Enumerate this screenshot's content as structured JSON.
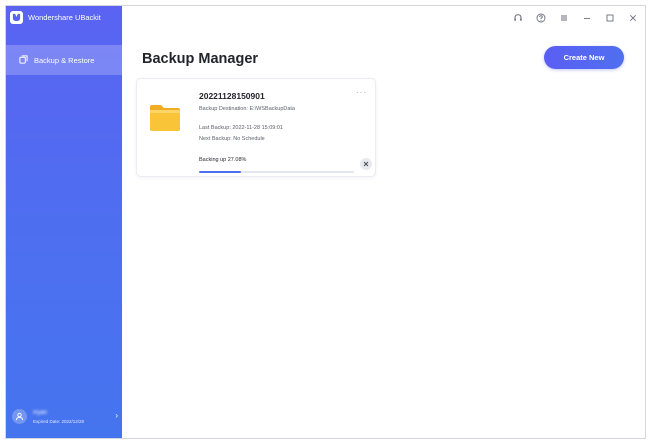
{
  "app": {
    "title": "Wondershare UBackit"
  },
  "sidebar": {
    "items": [
      {
        "label": "Backup & Restore",
        "icon": "backup-icon",
        "active": true
      }
    ],
    "user": {
      "name": "Ryan",
      "expiry": "Expired Date: 2022/12/28"
    }
  },
  "titlebar": {
    "controls": [
      "headset-icon",
      "help-icon",
      "menu-icon",
      "minimize-icon",
      "maximize-icon",
      "close-icon"
    ]
  },
  "main": {
    "title": "Backup Manager",
    "create_label": "Create New",
    "backups": [
      {
        "name": "20221128150901",
        "destination": "Backup Destination: E:\\WSBackupData",
        "last_backup": "Last Backup: 2022-11-28 15:09:01",
        "next_backup": "Next Backup: No Schedule",
        "status": "Backing up 27.08%",
        "progress": 27.08,
        "more_label": "···"
      }
    ]
  },
  "colors": {
    "accent": "#4f6ff0",
    "sidebar_top": "#5a63f2",
    "sidebar_bottom": "#4574ef",
    "folder": "#f9c437"
  }
}
